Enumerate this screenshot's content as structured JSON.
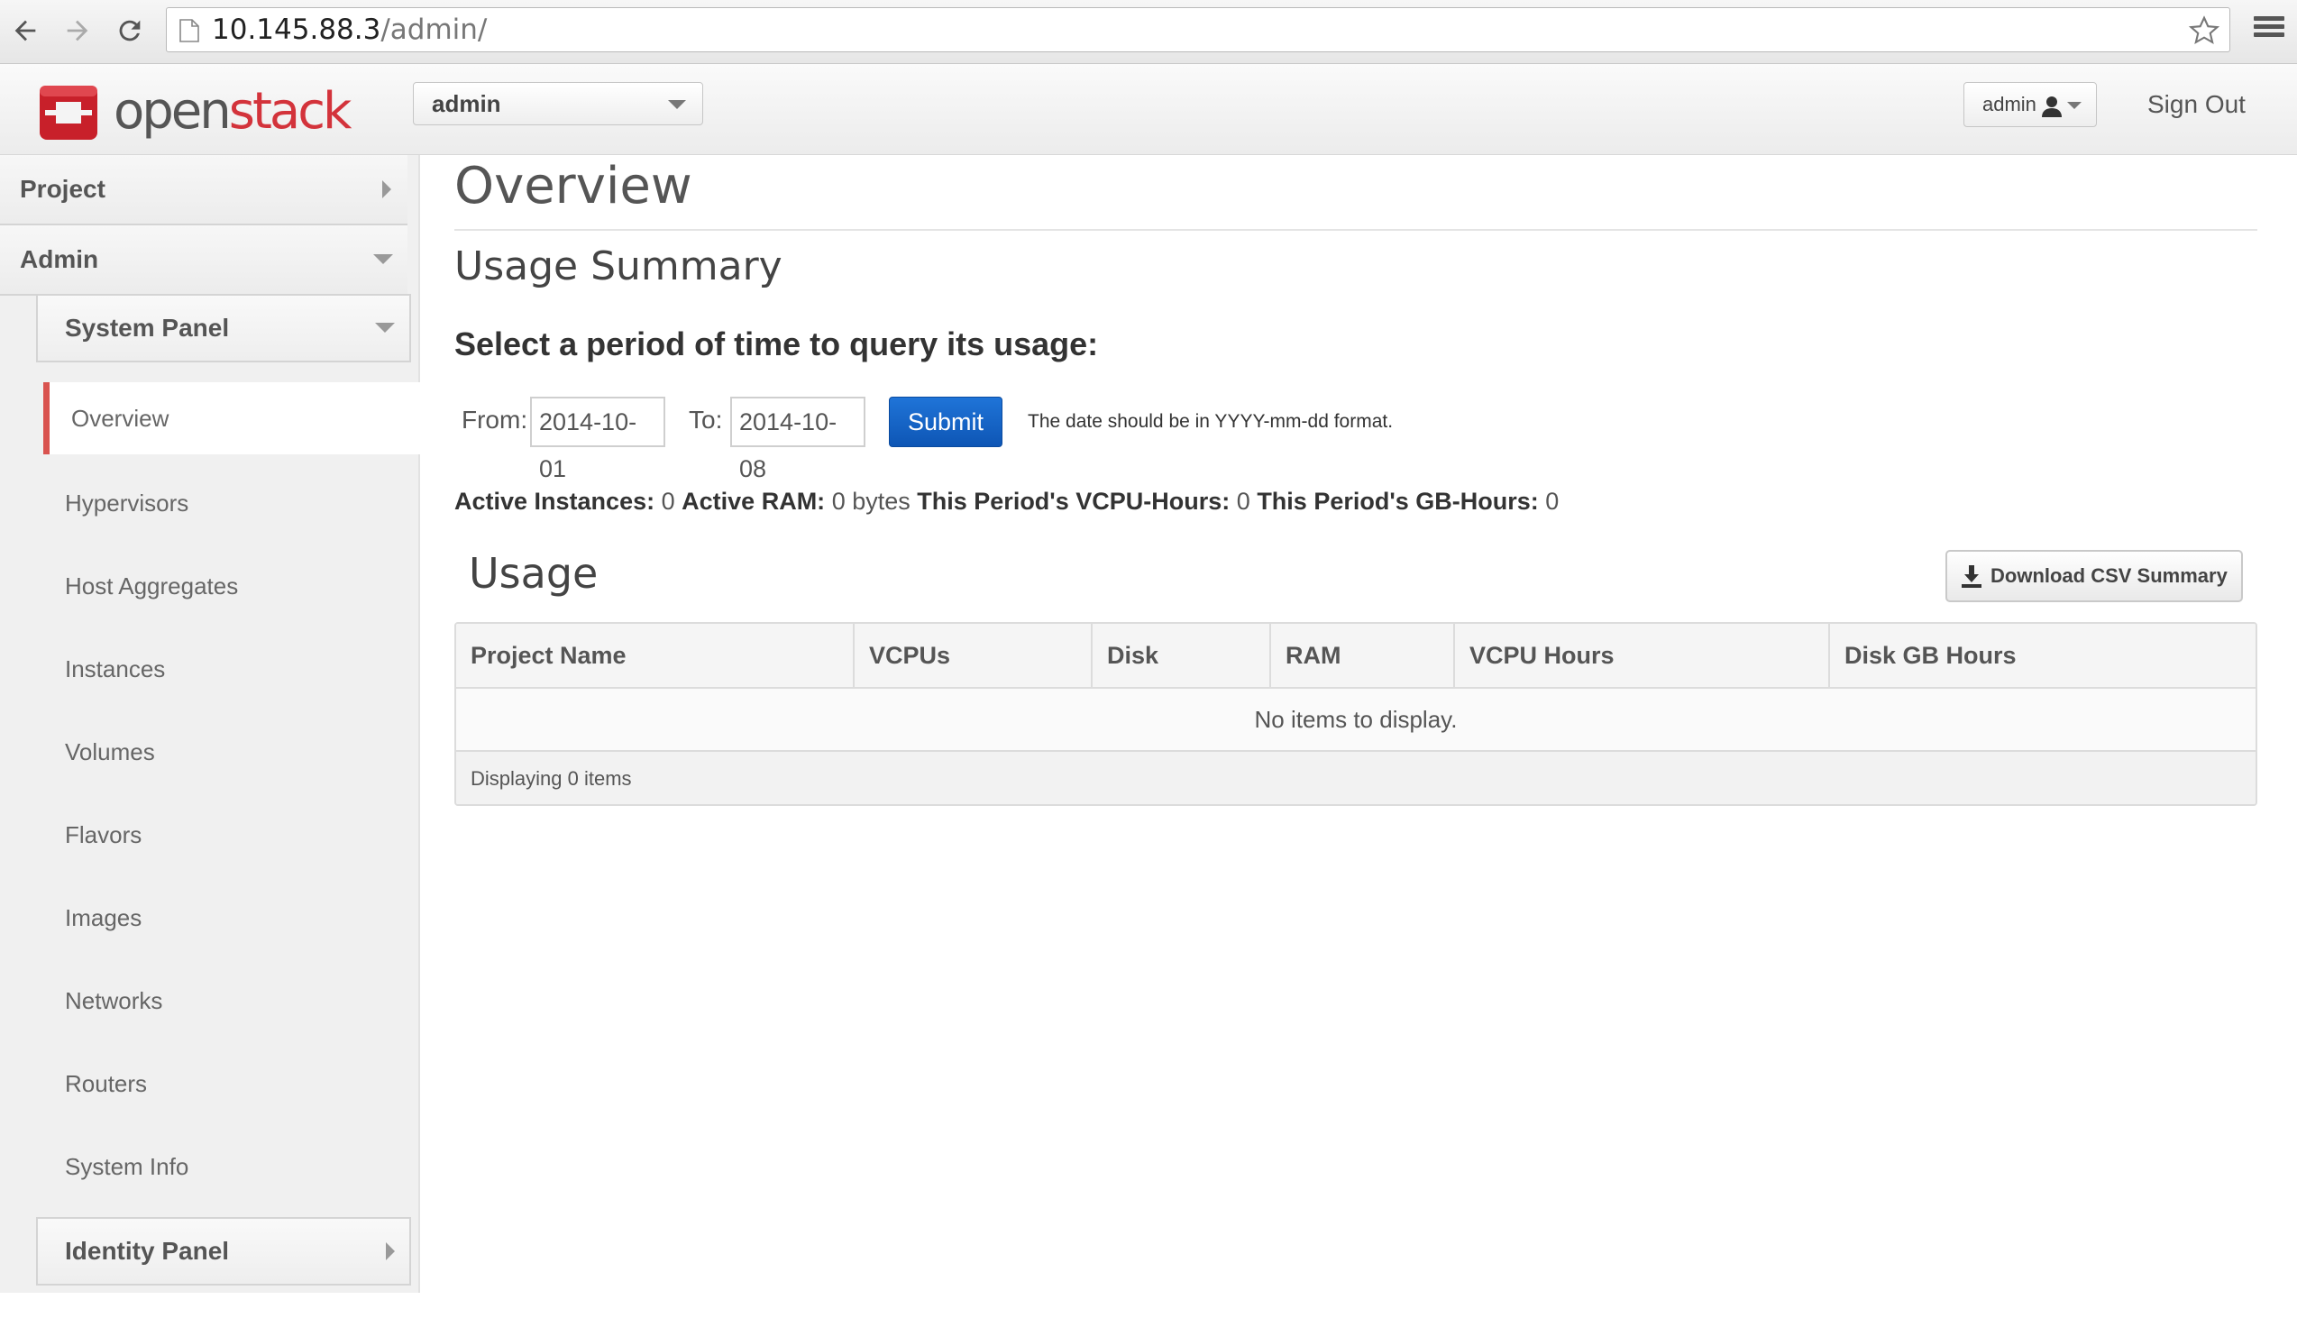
{
  "browser": {
    "url_host": "10.145.88.3",
    "url_path": "/admin/"
  },
  "header": {
    "logo_part1": "open",
    "logo_part2": "stack",
    "project_selected": "admin",
    "user_label": "admin",
    "signout_label": "Sign Out"
  },
  "sidebar": {
    "dashboards": [
      {
        "label": "Project"
      },
      {
        "label": "Admin"
      }
    ],
    "panels": [
      {
        "label": "System Panel"
      },
      {
        "label": "Identity Panel"
      }
    ],
    "active_item": "Overview",
    "items": [
      {
        "label": "Hypervisors"
      },
      {
        "label": "Host Aggregates"
      },
      {
        "label": "Instances"
      },
      {
        "label": "Volumes"
      },
      {
        "label": "Flavors"
      },
      {
        "label": "Images"
      },
      {
        "label": "Networks"
      },
      {
        "label": "Routers"
      },
      {
        "label": "System Info"
      }
    ]
  },
  "main": {
    "page_title": "Overview",
    "section_title": "Usage Summary",
    "query_heading": "Select a period of time to query its usage:",
    "form": {
      "from_label": "From:",
      "from_value": "2014-10-01",
      "to_label": "To:",
      "to_value": "2014-10-08",
      "submit_label": "Submit",
      "hint": "The date should be in YYYY-mm-dd format."
    },
    "stats": {
      "active_instances_label": "Active Instances:",
      "active_instances_value": "0",
      "active_ram_label": "Active RAM:",
      "active_ram_value": "0 bytes",
      "vcpu_hours_label": "This Period's VCPU-Hours:",
      "vcpu_hours_value": "0",
      "gb_hours_label": "This Period's GB-Hours:",
      "gb_hours_value": "0"
    },
    "usage": {
      "title": "Usage",
      "download_label": "Download CSV Summary",
      "columns": [
        "Project Name",
        "VCPUs",
        "Disk",
        "RAM",
        "VCPU Hours",
        "Disk GB Hours"
      ],
      "empty_message": "No items to display.",
      "footer": "Displaying 0 items"
    }
  },
  "colors": {
    "accent_red": "#d9534f",
    "submit_blue": "#1565c7"
  }
}
